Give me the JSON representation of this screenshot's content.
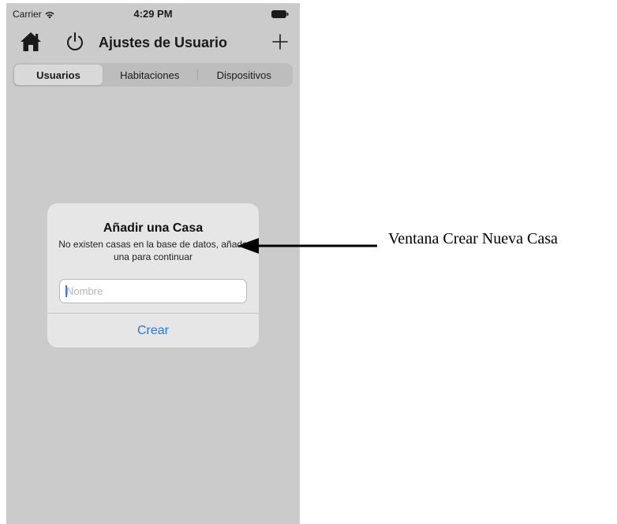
{
  "status_bar": {
    "carrier": "Carrier",
    "time": "4:29 PM",
    "icons": [
      "wifi-icon",
      "battery-icon"
    ]
  },
  "nav_bar": {
    "title": "Ajustes de Usuario",
    "left_icons": [
      "home-icon",
      "power-icon"
    ],
    "right_icon": "add-icon"
  },
  "segmented_control": {
    "segments": [
      {
        "label": "Usuarios",
        "selected": true
      },
      {
        "label": "Habitaciones",
        "selected": false
      },
      {
        "label": "Dispositivos",
        "selected": false
      }
    ]
  },
  "alert": {
    "title": "Añadir una Casa",
    "message": "No existen casas en la base de datos, añade una para continuar",
    "input": {
      "placeholder": "Nombre",
      "value": ""
    },
    "button_label": "Crear"
  },
  "annotation": {
    "label": "Ventana Crear Nueva Casa"
  },
  "colors": {
    "screen_background": "#cbcbcb",
    "alert_background": "#e6e6e6",
    "accent": "#1a7cf0"
  }
}
